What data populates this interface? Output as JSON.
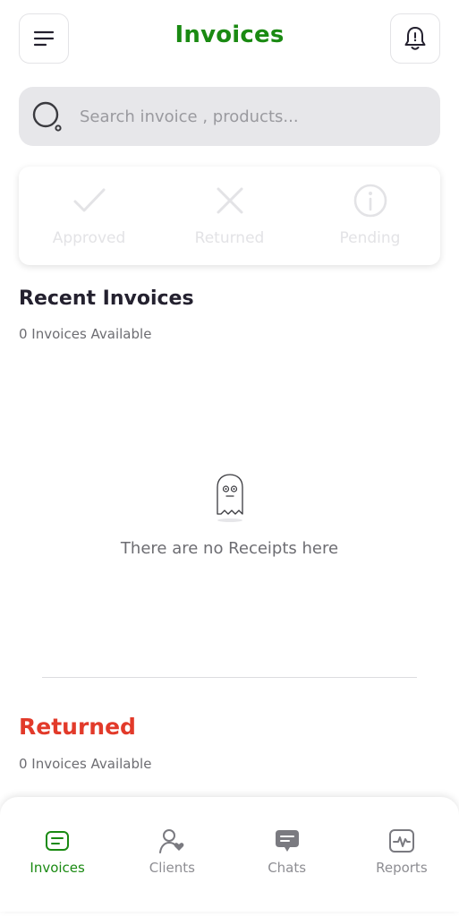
{
  "header": {
    "title": "Invoices"
  },
  "search": {
    "placeholder": "Search invoice , products..."
  },
  "status_tabs": [
    {
      "label": "Approved",
      "icon": "check-icon"
    },
    {
      "label": "Returned",
      "icon": "x-icon"
    },
    {
      "label": "Pending",
      "icon": "info-icon"
    }
  ],
  "recent": {
    "title": "Recent Invoices",
    "count_text": "0 Invoices Available",
    "empty_text": "There are no Receipts here"
  },
  "returned": {
    "title": "Returned",
    "count_text": "0 Invoices Available"
  },
  "nav": [
    {
      "label": "Invoices",
      "icon": "invoice-icon",
      "active": true
    },
    {
      "label": "Clients",
      "icon": "clients-icon",
      "active": false
    },
    {
      "label": "Chats",
      "icon": "chat-icon",
      "active": false
    },
    {
      "label": "Reports",
      "icon": "reports-icon",
      "active": false
    }
  ],
  "colors": {
    "brand_green": "#1a8a12",
    "returned_red": "#e23a2a",
    "muted_label": "#e3e3e6",
    "text_dark": "#24212f"
  }
}
